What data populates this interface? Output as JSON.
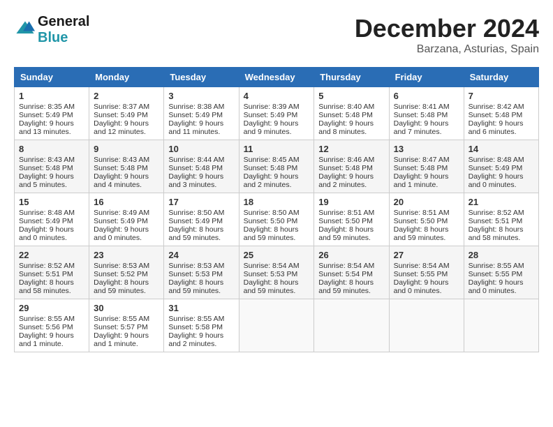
{
  "header": {
    "logo_line1": "General",
    "logo_line2": "Blue",
    "month": "December 2024",
    "location": "Barzana, Asturias, Spain"
  },
  "days_of_week": [
    "Sunday",
    "Monday",
    "Tuesday",
    "Wednesday",
    "Thursday",
    "Friday",
    "Saturday"
  ],
  "weeks": [
    [
      {
        "day": "1",
        "info": "Sunrise: 8:35 AM\nSunset: 5:49 PM\nDaylight: 9 hours and 13 minutes."
      },
      {
        "day": "2",
        "info": "Sunrise: 8:37 AM\nSunset: 5:49 PM\nDaylight: 9 hours and 12 minutes."
      },
      {
        "day": "3",
        "info": "Sunrise: 8:38 AM\nSunset: 5:49 PM\nDaylight: 9 hours and 11 minutes."
      },
      {
        "day": "4",
        "info": "Sunrise: 8:39 AM\nSunset: 5:49 PM\nDaylight: 9 hours and 9 minutes."
      },
      {
        "day": "5",
        "info": "Sunrise: 8:40 AM\nSunset: 5:48 PM\nDaylight: 9 hours and 8 minutes."
      },
      {
        "day": "6",
        "info": "Sunrise: 8:41 AM\nSunset: 5:48 PM\nDaylight: 9 hours and 7 minutes."
      },
      {
        "day": "7",
        "info": "Sunrise: 8:42 AM\nSunset: 5:48 PM\nDaylight: 9 hours and 6 minutes."
      }
    ],
    [
      {
        "day": "8",
        "info": "Sunrise: 8:43 AM\nSunset: 5:48 PM\nDaylight: 9 hours and 5 minutes."
      },
      {
        "day": "9",
        "info": "Sunrise: 8:43 AM\nSunset: 5:48 PM\nDaylight: 9 hours and 4 minutes."
      },
      {
        "day": "10",
        "info": "Sunrise: 8:44 AM\nSunset: 5:48 PM\nDaylight: 9 hours and 3 minutes."
      },
      {
        "day": "11",
        "info": "Sunrise: 8:45 AM\nSunset: 5:48 PM\nDaylight: 9 hours and 2 minutes."
      },
      {
        "day": "12",
        "info": "Sunrise: 8:46 AM\nSunset: 5:48 PM\nDaylight: 9 hours and 2 minutes."
      },
      {
        "day": "13",
        "info": "Sunrise: 8:47 AM\nSunset: 5:48 PM\nDaylight: 9 hours and 1 minute."
      },
      {
        "day": "14",
        "info": "Sunrise: 8:48 AM\nSunset: 5:49 PM\nDaylight: 9 hours and 0 minutes."
      }
    ],
    [
      {
        "day": "15",
        "info": "Sunrise: 8:48 AM\nSunset: 5:49 PM\nDaylight: 9 hours and 0 minutes."
      },
      {
        "day": "16",
        "info": "Sunrise: 8:49 AM\nSunset: 5:49 PM\nDaylight: 9 hours and 0 minutes."
      },
      {
        "day": "17",
        "info": "Sunrise: 8:50 AM\nSunset: 5:49 PM\nDaylight: 8 hours and 59 minutes."
      },
      {
        "day": "18",
        "info": "Sunrise: 8:50 AM\nSunset: 5:50 PM\nDaylight: 8 hours and 59 minutes."
      },
      {
        "day": "19",
        "info": "Sunrise: 8:51 AM\nSunset: 5:50 PM\nDaylight: 8 hours and 59 minutes."
      },
      {
        "day": "20",
        "info": "Sunrise: 8:51 AM\nSunset: 5:50 PM\nDaylight: 8 hours and 59 minutes."
      },
      {
        "day": "21",
        "info": "Sunrise: 8:52 AM\nSunset: 5:51 PM\nDaylight: 8 hours and 58 minutes."
      }
    ],
    [
      {
        "day": "22",
        "info": "Sunrise: 8:52 AM\nSunset: 5:51 PM\nDaylight: 8 hours and 58 minutes."
      },
      {
        "day": "23",
        "info": "Sunrise: 8:53 AM\nSunset: 5:52 PM\nDaylight: 8 hours and 59 minutes."
      },
      {
        "day": "24",
        "info": "Sunrise: 8:53 AM\nSunset: 5:53 PM\nDaylight: 8 hours and 59 minutes."
      },
      {
        "day": "25",
        "info": "Sunrise: 8:54 AM\nSunset: 5:53 PM\nDaylight: 8 hours and 59 minutes."
      },
      {
        "day": "26",
        "info": "Sunrise: 8:54 AM\nSunset: 5:54 PM\nDaylight: 8 hours and 59 minutes."
      },
      {
        "day": "27",
        "info": "Sunrise: 8:54 AM\nSunset: 5:55 PM\nDaylight: 9 hours and 0 minutes."
      },
      {
        "day": "28",
        "info": "Sunrise: 8:55 AM\nSunset: 5:55 PM\nDaylight: 9 hours and 0 minutes."
      }
    ],
    [
      {
        "day": "29",
        "info": "Sunrise: 8:55 AM\nSunset: 5:56 PM\nDaylight: 9 hours and 1 minute."
      },
      {
        "day": "30",
        "info": "Sunrise: 8:55 AM\nSunset: 5:57 PM\nDaylight: 9 hours and 1 minute."
      },
      {
        "day": "31",
        "info": "Sunrise: 8:55 AM\nSunset: 5:58 PM\nDaylight: 9 hours and 2 minutes."
      },
      {
        "day": "",
        "info": ""
      },
      {
        "day": "",
        "info": ""
      },
      {
        "day": "",
        "info": ""
      },
      {
        "day": "",
        "info": ""
      }
    ]
  ]
}
